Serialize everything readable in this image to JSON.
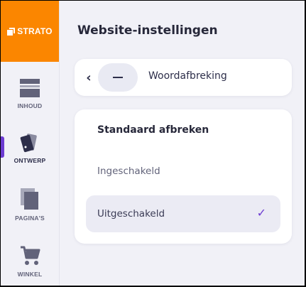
{
  "brand": {
    "name": "STRATO",
    "color": "#fb8600"
  },
  "sidebar": {
    "items": [
      {
        "label": "INHOUD",
        "icon": "content-icon"
      },
      {
        "label": "ONTWERP",
        "icon": "design-icon",
        "active": true
      },
      {
        "label": "PAGINA'S",
        "icon": "pages-icon"
      },
      {
        "label": "WINKEL",
        "icon": "cart-icon"
      }
    ]
  },
  "main": {
    "title": "Website-instellingen",
    "breadcrumb": {
      "label": "Woordafbreking"
    },
    "section": {
      "title": "Standaard afbreken",
      "options": [
        {
          "label": "Ingeschakeld",
          "selected": false
        },
        {
          "label": "Uitgeschakeld",
          "selected": true
        }
      ],
      "check_glyph": "✓"
    }
  },
  "colors": {
    "accent": "#6c3bd1",
    "background": "#f1f1f7",
    "icon": "#62637a"
  }
}
